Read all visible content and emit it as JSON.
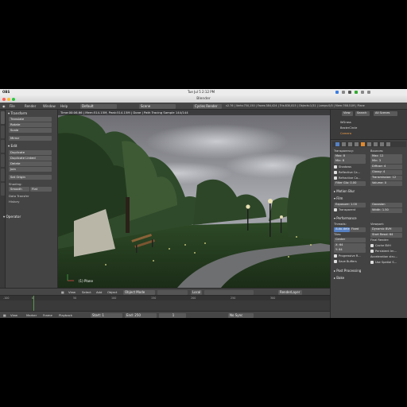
{
  "macos": {
    "app": "OBS",
    "clock": "Tue Jul 5  2:12 PM"
  },
  "window": {
    "title": "Blender"
  },
  "info_header": {
    "menus": [
      "File",
      "Render",
      "Window",
      "Help"
    ],
    "layout": "Default",
    "scene": "Scene",
    "engine": "Cycles Render",
    "stats": "v2.76 | Verts:750,150 | Faces:384,424 | Tris:830,815 | Objects:1/31 | Lamps:0/0 | Mem:768.51M | Plane"
  },
  "toolshelf": {
    "transform_header": "Transform",
    "transform_buttons": [
      "Translate",
      "Rotate",
      "Scale"
    ],
    "mirror": "Mirror",
    "edit_header": "Edit",
    "edit_buttons": [
      "Duplicate",
      "Duplicate Linked",
      "Delete",
      "Join"
    ],
    "set_origin": "Set Origin",
    "shading_label": "Shading:",
    "smooth": "Smooth",
    "flat": "Flat",
    "data_transfer": "Data Transfer",
    "history": "History",
    "operator_header": "Operator"
  },
  "viewport": {
    "header_text": "Time:00:06.66 | Mem:514.15M, Peak:514.15M | Done | Path Tracing Sample 144/144",
    "object_label": "(1) Plane"
  },
  "viewport_footer": {
    "items": [
      "View",
      "Select",
      "Add",
      "Object"
    ],
    "mode": "Object Mode",
    "orientation": "Local",
    "layer": "RenderLayer"
  },
  "outliner": {
    "buttons": [
      "View",
      "Search"
    ],
    "filter": "All Scenes",
    "rows": [
      "WGrass",
      "BezierCircle",
      "Camera"
    ]
  },
  "properties": {
    "transparency_label": "Transparency:",
    "bounces_label": "Bounces:",
    "max1": "Max:",
    "max1_val": "8",
    "min1": "Min:",
    "min1_val": "8",
    "max2": "Max:",
    "max2_val": "12",
    "min2": "Min:",
    "min2_val": "3",
    "shadows": "Shadows",
    "reflective": "Reflective Ca...",
    "refractive": "Refractive Ca...",
    "filter_glossy": "Filter Glo: 0.00",
    "diffuse": "Diffuse:",
    "diffuse_val": "4",
    "glossy": "Glossy:",
    "glossy_val": "4",
    "transmission": "Transmission:",
    "transmission_val": "12",
    "volume": "Volume:",
    "volume_val": "0",
    "motion_blur": "Motion Blur",
    "film": "Film",
    "exposure": "Exposure: 1.00",
    "gaussian": "Gaussian",
    "transparent": "Transparent",
    "width": "Width:",
    "width_val": "1.50",
    "performance": "Performance",
    "threads": "Threads:",
    "viewport": "Viewport:",
    "auto_detect": "Auto-detect",
    "fixed": "Fixed",
    "dynamic_bvh": "Dynamic BVH",
    "tiles": "Tiles:",
    "start_res": "Start Resol: 64",
    "center": "Center",
    "final_render": "Final Render:",
    "x": "X:",
    "x_val": "64",
    "y": "Y:",
    "y_val": "64",
    "cache_bvh": "Cache BVH",
    "persistent": "Persistent Im...",
    "progressive": "Progressive R...",
    "acceleration": "Acceleration stru...",
    "save_buffers": "Save Buffers",
    "use_spatial": "Use Spatial S...",
    "post_processing": "Post Processing",
    "bake": "Bake"
  },
  "timeline": {
    "ticks": [
      "-100",
      "0",
      "50",
      "100",
      "150",
      "200",
      "250",
      "300"
    ],
    "menus": [
      "View",
      "Marker",
      "Frame",
      "Playback"
    ],
    "start": "Start:",
    "start_val": "1",
    "end": "End:",
    "end_val": "250",
    "current": "1",
    "sync": "No Sync"
  },
  "colors": {
    "accent": "#5680c2",
    "active_tab": "#e0892e"
  }
}
